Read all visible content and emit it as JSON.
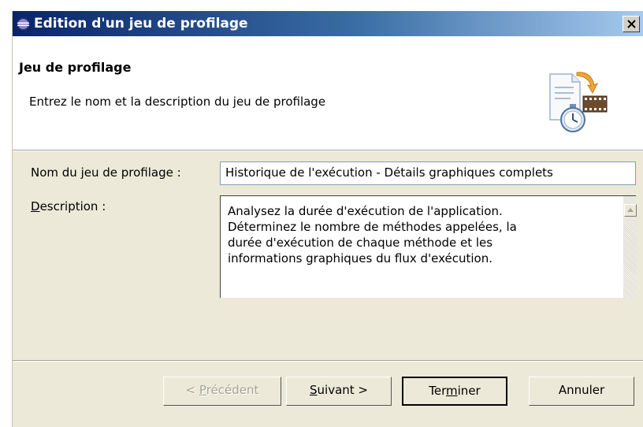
{
  "window": {
    "title": "Edition d'un jeu de profilage",
    "close_label": "Close"
  },
  "banner": {
    "title": "Jeu de profilage",
    "description": "Entrez le nom et la description du jeu de profilage",
    "image_icon": "profiling-set-wizard-icon"
  },
  "form": {
    "name_label": "Nom du jeu de profilage :",
    "name_value": "Historique de l'exécution - Détails graphiques complets",
    "description_label_mnemonic": "D",
    "description_label_rest": "escription :",
    "description_value": "Analysez la durée d'exécution de l'application.\nDéterminez le nombre de méthodes appelées, la\ndurée d'exécution de chaque méthode et les\ninformations graphiques du flux d'exécution."
  },
  "buttons": {
    "previous": {
      "prefix": "< ",
      "mnemonic": "P",
      "rest": "récédent",
      "enabled": false
    },
    "next": {
      "mnemonic": "S",
      "rest": "uivant >",
      "enabled": true
    },
    "finish": {
      "prefix": "Ter",
      "mnemonic": "m",
      "rest": "iner",
      "enabled": true,
      "default": true
    },
    "cancel": {
      "label": "Annuler",
      "enabled": true
    }
  },
  "icons": {
    "window": "eclipse-icon",
    "close": "close-icon",
    "scroll_up": "scroll-up-arrow-icon"
  },
  "colors": {
    "titlebar_start": "#0a246a",
    "titlebar_end": "#a6caf0",
    "dialog_bg": "#ece9d8"
  }
}
